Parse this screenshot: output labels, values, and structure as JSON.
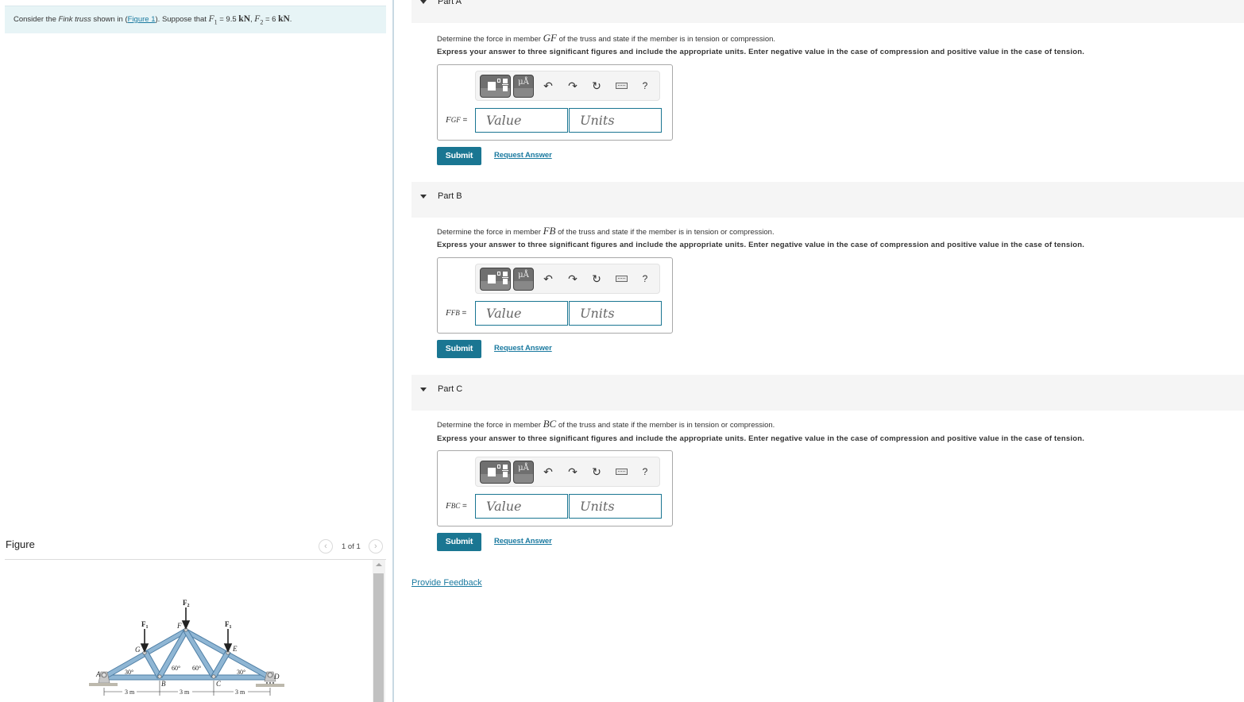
{
  "intro": {
    "prefix": "Consider the ",
    "emphasis": "Fink truss",
    "mid": " shown in (",
    "figure_link": "Figure 1",
    "after_link": "). Suppose that ",
    "f1_symbol": "F",
    "f1_sub": "1",
    "f1_value": " = 9.5 ",
    "f1_unit": "kN",
    "sep": ", ",
    "f2_symbol": "F",
    "f2_sub": "2",
    "f2_value": " = 6 ",
    "f2_unit": "kN",
    "end": "."
  },
  "figure": {
    "title": "Figure",
    "count": "1 of 1",
    "prev_icon": "chevron-left-icon",
    "next_icon": "chevron-right-icon",
    "diagram": {
      "labels": {
        "A": "A",
        "B": "B",
        "C": "C",
        "D": "D",
        "E": "E",
        "F": "F",
        "G": "G",
        "F1": "F",
        "F1_sub": "1",
        "F2": "F",
        "F2_sub": "2",
        "angle_left": "30°",
        "angle_right": "30°",
        "angle_b": "60°",
        "angle_c": "60°",
        "span1": "3 m",
        "span2": "3 m",
        "span3": "3 m"
      },
      "colors": {
        "member": "#8fb6d4",
        "member_edge": "#4f7fa5",
        "support": "#c8c8c8",
        "arrow": "#222222"
      }
    }
  },
  "parts": [
    {
      "title": "Part A",
      "question_prefix": "Determine the force in member ",
      "member": "GF",
      "question_suffix": " of the truss and state if the member is in tension or compression.",
      "instructions": "Express your answer to three significant figures and include the appropriate units. Enter negative value in the case of compression and positive value in the case of tension.",
      "label_symbol": "F",
      "label_sub": "GF",
      "label_eq": " =",
      "value_placeholder": "Value",
      "units_placeholder": "Units",
      "submit": "Submit",
      "request": "Request Answer"
    },
    {
      "title": "Part B",
      "question_prefix": "Determine the force in member ",
      "member": "FB",
      "question_suffix": " of the truss and state if the member is in tension or compression.",
      "instructions": "Express your answer to three significant figures and include the appropriate units. Enter negative value in the case of compression and positive value in the case of tension.",
      "label_symbol": "F",
      "label_sub": "FB",
      "label_eq": " =",
      "value_placeholder": "Value",
      "units_placeholder": "Units",
      "submit": "Submit",
      "request": "Request Answer"
    },
    {
      "title": "Part C",
      "question_prefix": "Determine the force in member ",
      "member": "BC",
      "question_suffix": " of the truss and state if the member is in tension or compression.",
      "instructions": "Express your answer to three significant figures and include the appropriate units. Enter negative value in the case of compression and positive value in the case of tension.",
      "label_symbol": "F",
      "label_sub": "BC",
      "label_eq": " =",
      "value_placeholder": "Value",
      "units_placeholder": "Units",
      "submit": "Submit",
      "request": "Request Answer"
    }
  ],
  "toolbar": {
    "templates_icon": "templates-icon",
    "symbols_label": "μÅ",
    "undo_glyph": "↶",
    "redo_glyph": "↷",
    "reset_glyph": "↻",
    "keyboard_icon": "keyboard-icon",
    "help_label": "?"
  },
  "feedback": "Provide Feedback",
  "colors": {
    "accent": "#1a7692",
    "link": "#1b7aa0",
    "intro_bg": "#e7f4f6",
    "part_header_bg": "#f5f5f5"
  }
}
